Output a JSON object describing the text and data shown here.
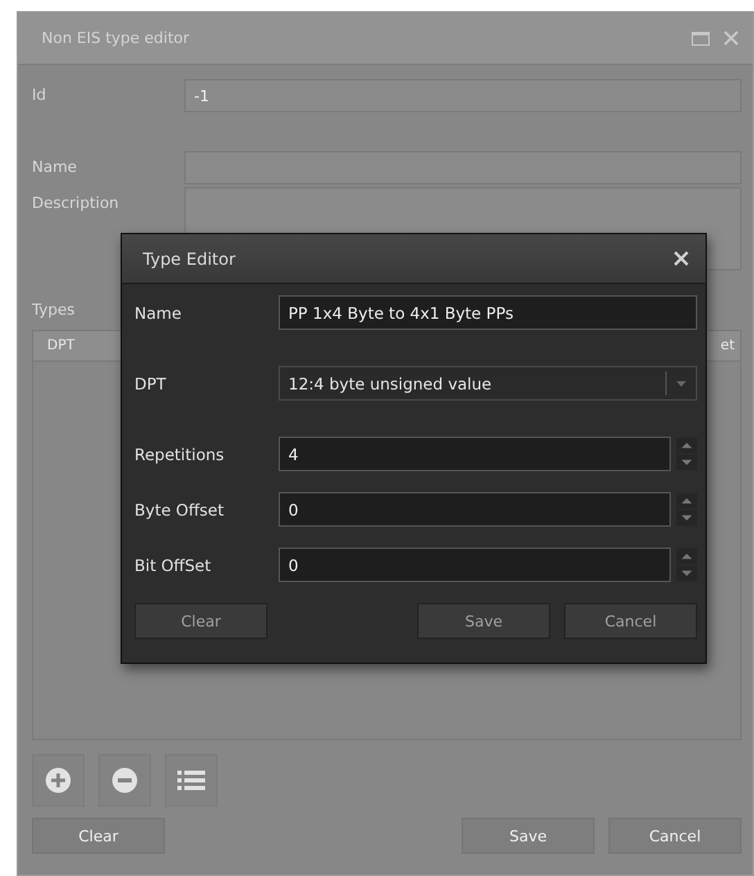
{
  "window": {
    "title": "Non EIS type editor"
  },
  "fields": [
    {
      "label": "Id",
      "value": "-1",
      "kind": "line"
    },
    {
      "label": "Name",
      "kind": "line"
    },
    {
      "label": "Description",
      "kind": "area"
    }
  ],
  "types": {
    "label": "Types",
    "columns": [
      "DPT",
      "et"
    ]
  },
  "toolbar": [
    {
      "kind": "add"
    },
    {
      "kind": "remove"
    },
    {
      "kind": "list"
    }
  ],
  "buttons": {
    "left": [
      "Clear"
    ],
    "right": [
      "Save",
      "Cancel"
    ]
  },
  "dialog": {
    "title": "Type Editor",
    "fields": [
      {
        "label": "Name",
        "value": "PP 1x4 Byte to 4x1 Byte PPs",
        "kind": "text"
      },
      {
        "label": "DPT",
        "value": "12:4 byte unsigned value",
        "kind": "select"
      },
      {
        "label": "Repetitions",
        "value": "4",
        "kind": "spin"
      },
      {
        "label": "Byte Offset",
        "value": "0",
        "kind": "spin"
      },
      {
        "label": "Bit OffSet",
        "value": "0",
        "kind": "spin"
      }
    ],
    "buttons": {
      "left": [
        "Clear"
      ],
      "right": [
        "Save",
        "Cancel"
      ]
    }
  }
}
